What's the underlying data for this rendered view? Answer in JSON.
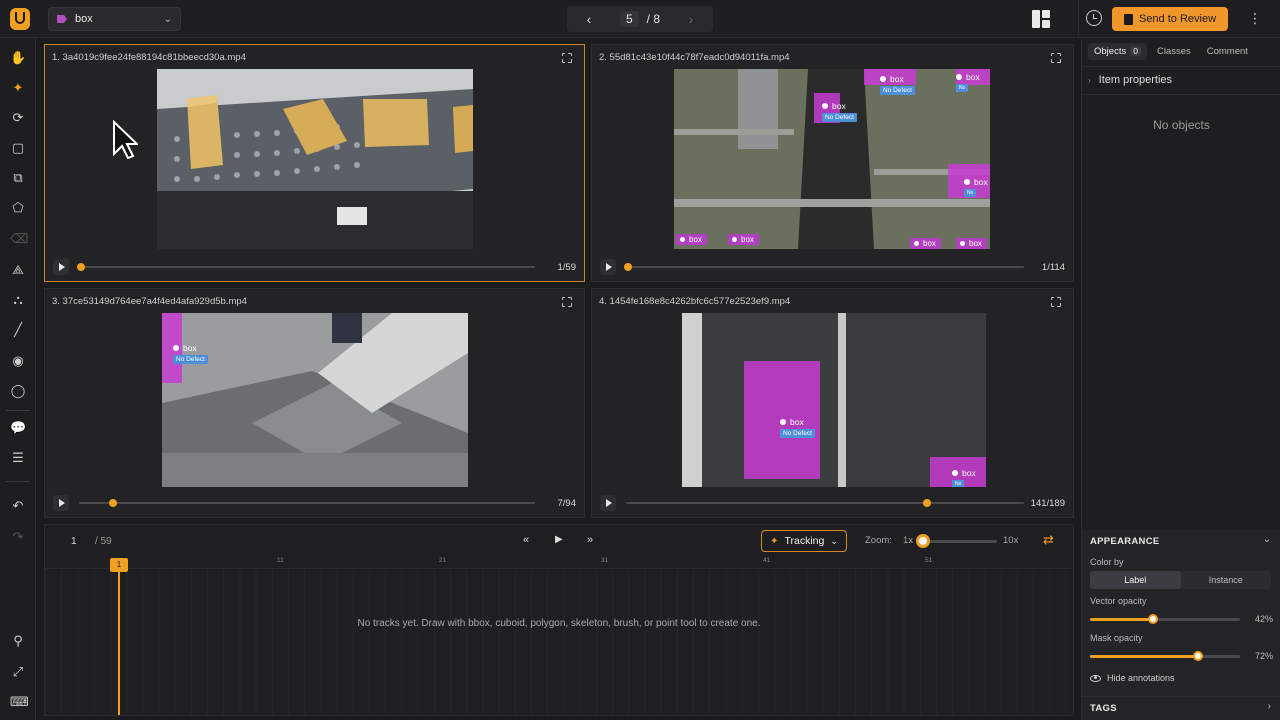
{
  "topbar": {
    "label_select": "box",
    "pager_current": "5",
    "pager_total": "/ 8",
    "review_button": "Send to Review"
  },
  "panels": [
    {
      "title": "1. 3a4019c9fee24fe88194c81bbeecd30a.mp4",
      "frame_counter": "1/59",
      "progress": 0.0
    },
    {
      "title": "2. 55d81c43e10f44c78f7eadc0d94011fa.mp4",
      "frame_counter": "1/114",
      "progress": 0.0
    },
    {
      "title": "3. 37ce53149d764ee7a4f4ed4afa929d5b.mp4",
      "frame_counter": "7/94",
      "progress": 0.07
    },
    {
      "title": "4. 1454fe168e8c4262bfc6c577e2523ef9.mp4",
      "frame_counter": "141/189",
      "progress": 0.75
    }
  ],
  "annotations": {
    "label": "box",
    "attribute": "No Defect"
  },
  "timeline": {
    "frame": "1",
    "total": "/ 59",
    "tracking_button": "Tracking",
    "zoom_label": "Zoom:",
    "zoom_min": "1x",
    "zoom_max": "10x",
    "ruler_ticks": [
      "11",
      "21",
      "31",
      "41",
      "51"
    ],
    "playhead": "1",
    "empty_message": "No tracks yet. Draw with bbox, cuboid, polygon, skeleton, brush, or point tool to create one."
  },
  "right_panel": {
    "tabs": [
      {
        "label": "Objects",
        "badge": "0"
      },
      {
        "label": "Classes"
      },
      {
        "label": "Comment"
      }
    ],
    "item_properties": "Item properties",
    "no_objects": "No objects",
    "appearance": {
      "title": "APPEARANCE",
      "color_by": "Color by",
      "segments": [
        "Label",
        "Instance"
      ],
      "vector_opacity_label": "Vector opacity",
      "vector_opacity_value": "42%",
      "vector_opacity": 0.42,
      "mask_opacity_label": "Mask opacity",
      "mask_opacity_value": "72%",
      "mask_opacity": 0.72,
      "hide_annotations": "Hide annotations"
    },
    "tags_title": "TAGS"
  },
  "colors": {
    "accent": "#f0a020",
    "annotation": "#c83cd2",
    "attribute_tag": "#4d8fd8",
    "background": "#1b1b1d"
  },
  "icons": {
    "toolbar": [
      "hand-icon",
      "magic-wand-icon",
      "smart-polygon-icon",
      "bbox-icon",
      "cuboid-icon",
      "polygon-icon",
      "eraser-icon",
      "polyline-icon",
      "skeleton-icon",
      "line-icon",
      "point-icon",
      "circle-icon",
      "comment-icon",
      "settings-sliders-icon",
      "undo-icon",
      "redo-icon",
      "zoom-icon",
      "fit-icon",
      "keyboard-icon"
    ]
  }
}
